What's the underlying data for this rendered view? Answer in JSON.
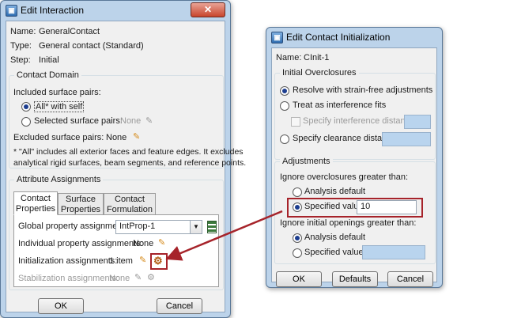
{
  "edit_interaction": {
    "title": "Edit Interaction",
    "name_label": "Name:",
    "name_value": "GeneralContact",
    "type_label": "Type:",
    "type_value": "General contact (Standard)",
    "step_label": "Step:",
    "step_value": "Initial",
    "contact_domain": {
      "title": "Contact Domain",
      "included_label": "Included surface pairs:",
      "all_self": "All* with self",
      "selected_pairs": "Selected surface pairs:",
      "selected_value": "None",
      "excluded_label": "Excluded surface pairs:",
      "excluded_value": "None",
      "note_line1": "* \"All\" includes all exterior faces and feature edges. It excludes",
      "note_line2": "analytical rigid surfaces, beam segments, and reference points."
    },
    "attribute_assignments": {
      "title": "Attribute Assignments",
      "tabs": [
        {
          "line1": "Contact",
          "line2": "Properties"
        },
        {
          "line1": "Surface",
          "line2": "Properties"
        },
        {
          "line1": "Contact",
          "line2": "Formulation"
        }
      ],
      "global_label": "Global property assignment:",
      "global_value": "IntProp-1",
      "individual_label": "Individual property assignments:",
      "individual_value": "None",
      "initialization_label": "Initialization assignments:",
      "initialization_value": "1 item",
      "stabilization_label": "Stabilization assignments:",
      "stabilization_value": "None"
    },
    "ok": "OK",
    "cancel": "Cancel"
  },
  "edit_contact_init": {
    "title": "Edit Contact Initialization",
    "name_label": "Name:",
    "name_value": "CInit-1",
    "initial_overclosures": {
      "title": "Initial Overclosures",
      "resolve": "Resolve with strain-free adjustments",
      "treat": "Treat as interference fits",
      "specify_interference": "Specify interference distance:",
      "specify_clearance": "Specify clearance distance:"
    },
    "adjustments": {
      "title": "Adjustments",
      "ignore_overclosures": "Ignore overclosures greater than:",
      "analysis_default_1": "Analysis default",
      "specified_value_1": "Specified value:",
      "specified_value_1_input": "10",
      "ignore_openings": "Ignore initial openings greater than:",
      "analysis_default_2": "Analysis default",
      "specified_value_2": "Specified value:"
    },
    "ok": "OK",
    "defaults": "Defaults",
    "cancel": "Cancel"
  },
  "colors": {
    "highlight_red": "#a6232a",
    "window_frame": "#bcd3ea",
    "disabled_field": "#b9d4ee"
  }
}
